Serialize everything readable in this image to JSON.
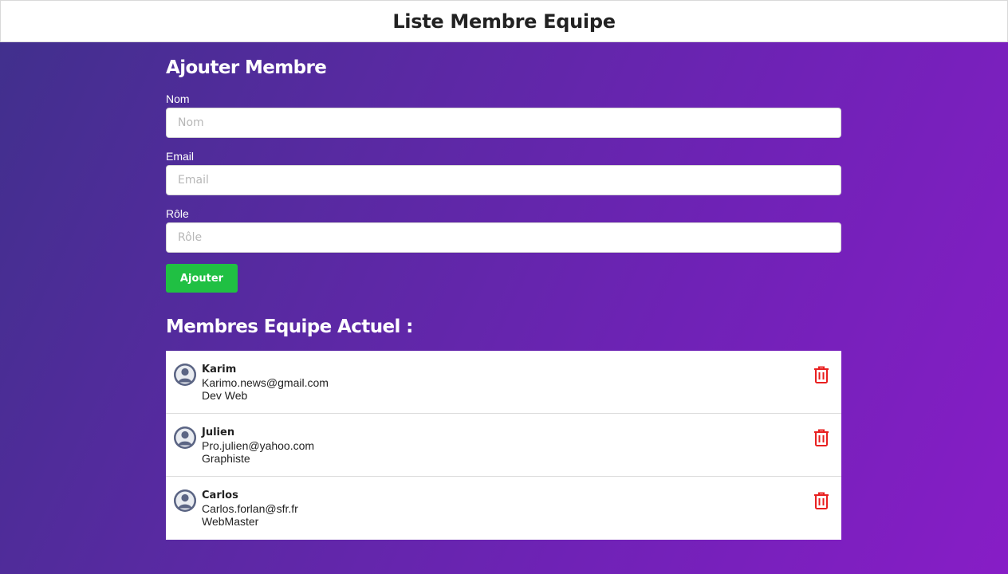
{
  "header": {
    "title": "Liste Membre Equipe"
  },
  "form": {
    "title": "Ajouter Membre",
    "fields": [
      {
        "label": "Nom",
        "placeholder": "Nom",
        "value": ""
      },
      {
        "label": "Email",
        "placeholder": "Email",
        "value": ""
      },
      {
        "label": "Rôle",
        "placeholder": "Rôle",
        "value": ""
      }
    ],
    "submit_label": "Ajouter"
  },
  "list": {
    "title": "Membres Equipe Actuel :",
    "members": [
      {
        "name": "Karim",
        "email": "Karimo.news@gmail.com",
        "role": "Dev Web"
      },
      {
        "name": "Julien",
        "email": "Pro.julien@yahoo.com",
        "role": "Graphiste"
      },
      {
        "name": "Carlos",
        "email": "Carlos.forlan@sfr.fr",
        "role": "WebMaster"
      }
    ]
  },
  "icons": {
    "avatar": "user-avatar-icon",
    "delete": "trash-icon"
  },
  "colors": {
    "accent_button": "#20c043",
    "delete_icon": "#e82020",
    "avatar": "#5b6584"
  }
}
